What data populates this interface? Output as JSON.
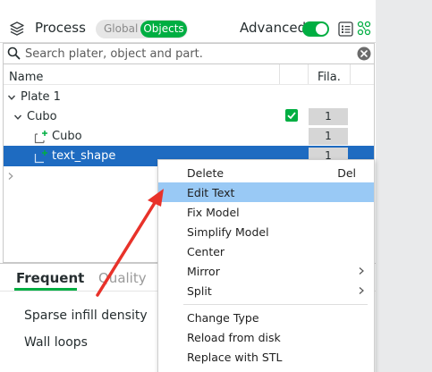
{
  "header": {
    "title": "Process",
    "segment": {
      "global": "Global",
      "objects": "Objects",
      "active": "Objects"
    },
    "advanced_label": "Advanced",
    "advanced_on": true,
    "accent_color": "#00ae42"
  },
  "search": {
    "placeholder": "Search plater, object and part.",
    "value": ""
  },
  "tree": {
    "columns": {
      "name": "Name",
      "filament": "Fila."
    },
    "rows": [
      {
        "label": "Plate 1",
        "level": 0,
        "expanded": true
      },
      {
        "label": "Cubo",
        "level": 1,
        "expanded": true,
        "checked": true,
        "filament": "1"
      },
      {
        "label": "Cubo",
        "level": 2,
        "filament": "1"
      },
      {
        "label": "text_shape",
        "level": 2,
        "filament": "1",
        "selected": true
      }
    ]
  },
  "bottom": {
    "tabs": {
      "frequent": "Frequent",
      "quality": "Quality",
      "active": "Frequent"
    },
    "settings": [
      "Sparse infill density",
      "Wall loops"
    ]
  },
  "context_menu": {
    "items": [
      {
        "label": "Delete",
        "shortcut": "Del"
      },
      {
        "label": "Edit Text",
        "highlighted": true
      },
      {
        "label": "Fix Model"
      },
      {
        "label": "Simplify Model"
      },
      {
        "label": "Center"
      },
      {
        "label": "Mirror",
        "submenu": true
      },
      {
        "label": "Split",
        "submenu": true
      },
      {
        "label": "Change Type"
      },
      {
        "label": "Reload from disk"
      },
      {
        "label": "Replace with STL"
      }
    ],
    "highlight_color": "#99c9f5"
  },
  "annotation": {
    "color": "#e8322a"
  }
}
